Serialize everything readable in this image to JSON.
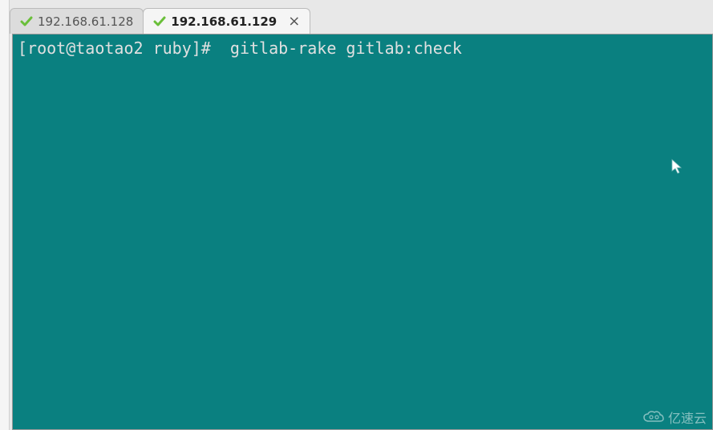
{
  "tabs": [
    {
      "label": "192.168.61.128",
      "active": false,
      "closable": false
    },
    {
      "label": "192.168.61.129",
      "active": true,
      "closable": true
    }
  ],
  "terminal": {
    "prompt": "[root@taotao2 ruby]# ",
    "command": " gitlab-rake gitlab:check"
  },
  "watermark": {
    "text": "亿速云"
  },
  "icons": {
    "check_color": "#6abf3a",
    "close_glyph": "×"
  }
}
